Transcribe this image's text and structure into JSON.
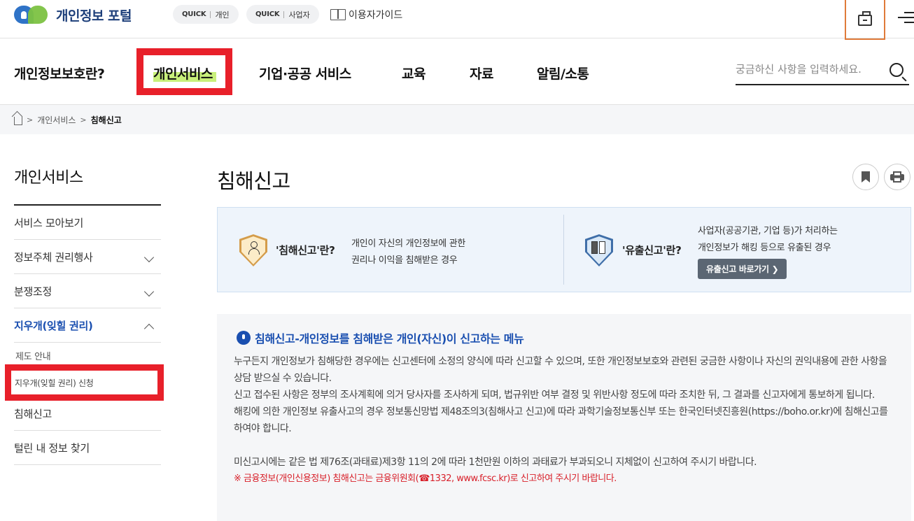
{
  "header": {
    "logo_text": "개인정보 포털",
    "quick_personal": {
      "tag": "QUICK",
      "label": "개인"
    },
    "quick_business": {
      "tag": "QUICK",
      "label": "사업자"
    },
    "guide_label": "이용자가이드",
    "accent_color": "#e8202a"
  },
  "gnb": {
    "items": [
      "개인정보보호란?",
      "개인서비스",
      "기업·공공 서비스",
      "교육",
      "자료",
      "알림/소통"
    ],
    "active_index": 1,
    "search_placeholder": "궁금하신 사항을 입력하세요."
  },
  "breadcrumb": {
    "items": [
      "개인서비스",
      "침해신고"
    ]
  },
  "lnb": {
    "title": "개인서비스",
    "items": [
      {
        "label": "서비스 모아보기"
      },
      {
        "label": "정보주체 권리행사"
      },
      {
        "label": "분쟁조정"
      },
      {
        "label": "지우개(잊힐 권리)"
      }
    ],
    "sub_items": [
      "제도 안내",
      "지우개(잊힐 권리) 신청"
    ],
    "after_items": [
      {
        "label": "침해신고"
      },
      {
        "label": "털린 내 정보 찾기"
      }
    ]
  },
  "main": {
    "title": "침해신고",
    "info": {
      "left_label": "'침해신고'란?",
      "left_desc_1": "개인이 자신의 개인정보에 관한",
      "left_desc_2": "권리나 이익을 침해받은 경우",
      "right_label": "'유출신고'란?",
      "right_desc_1": "사업자(공공기관, 기업 등)가 처리하는",
      "right_desc_2": "개인정보가 해킹 등으로 유출된 경우",
      "right_button": "유출신고 바로가기 ❯"
    },
    "notice": {
      "heading": "침해신고-개인정보를 침해받은 개인(자신)이 신고하는 메뉴",
      "p1": "누구든지 개인정보가 침해당한 경우에는 신고센터에 소정의 양식에 따라 신고할 수 있으며, 또한 개인정보보호와 관련된 궁금한 사항이나 자신의 권익내용에 관한 사항을 상담 받으실 수 있습니다.",
      "p2": "신고 접수된 사항은 정부의 조사계획에 의거 당사자를 조사하게 되며, 법규위반 여부 결정 및 위반사항 정도에 따라 조치한 뒤, 그 결과를 신고자에게 통보하게 됩니다.",
      "p3": "해킹에 의한 개인정보 유출사고의 경우 정보통신망법 제48조의3(침해사고 신고)에 따라 과학기술정보통신부 또는 한국인터넷진흥원(https://boho.or.kr)에 침해신고를 하여야 합니다.",
      "p4": "미신고시에는 같은 법 제76조(과태료)제3항 11의 2에 따라 1천만원 이하의 과태료가 부과되오니 지체없이 신고하여 주시기 바랍니다.",
      "red": "※ 금융정보(개인신용정보) 침해신고는 금융위원회(☎1332, www.fcsc.kr)로 신고하여 주시기 바랍니다."
    }
  }
}
